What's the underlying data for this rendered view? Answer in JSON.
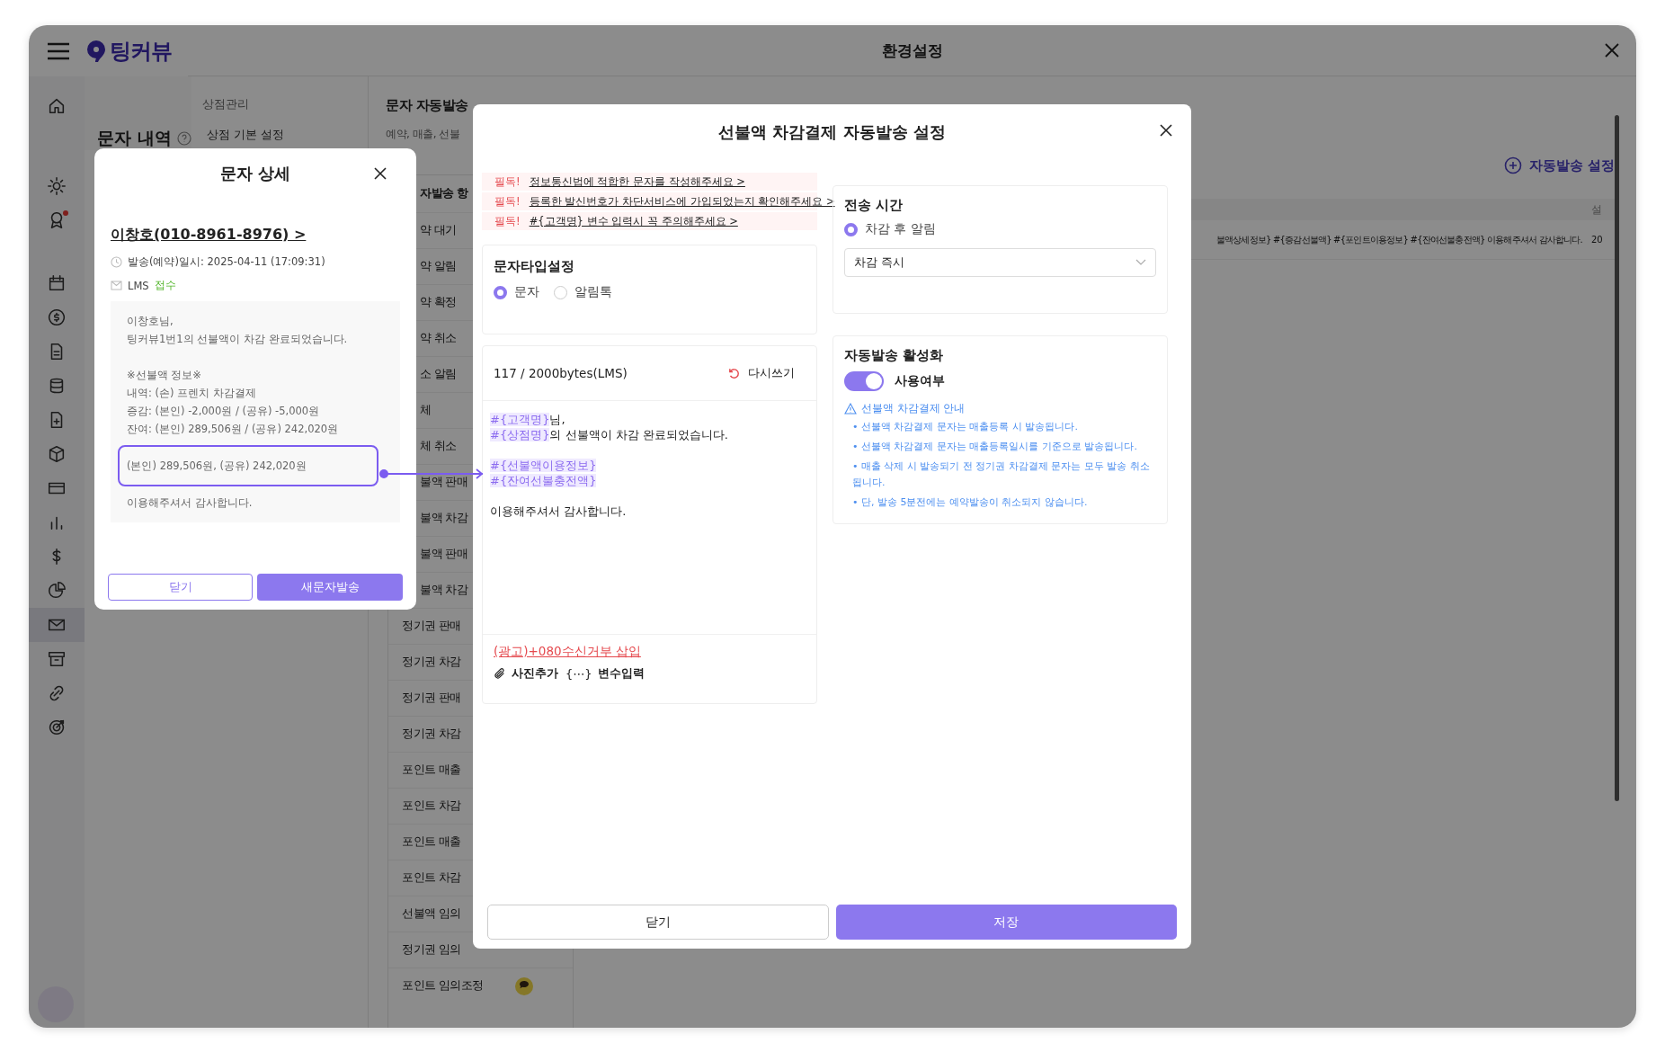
{
  "app": {
    "logo": "팅커뷰",
    "page_title": "문자 내역",
    "nav_groups": [
      [
        {
          "selected": false,
          "dot": false
        }
      ],
      [
        {
          "selected": false,
          "dot": false
        },
        {
          "selected": false,
          "dot": true
        }
      ],
      [
        {
          "selected": false,
          "dot": false
        },
        {
          "selected": false,
          "dot": false
        },
        {
          "selected": false,
          "dot": false
        },
        {
          "selected": false,
          "dot": false
        },
        {
          "selected": false,
          "dot": false
        },
        {
          "selected": false,
          "dot": false
        },
        {
          "selected": false,
          "dot": false
        },
        {
          "selected": false,
          "dot": false
        },
        {
          "selected": false,
          "dot": false
        },
        {
          "selected": false,
          "dot": false
        },
        {
          "selected": true,
          "dot": false
        },
        {
          "selected": false,
          "dot": false
        },
        {
          "selected": false,
          "dot": false
        },
        {
          "selected": false,
          "dot": false
        }
      ]
    ]
  },
  "settings_window": {
    "title": "환경설정",
    "nav": [
      {
        "kind": "group",
        "label": "상점관리"
      },
      {
        "kind": "item",
        "label": "상점 기본 설정"
      }
    ],
    "section_title": "문자 자동발송",
    "section_subtitle": "예약, 매출, 선불",
    "list_header": "자발송 항",
    "list_items_cut": [
      "약 대기",
      "약 알림",
      "약 확정",
      "약 취소",
      "소 알림",
      "체",
      "체 취소",
      "불액 판매",
      "불액 차감",
      "불액 판매",
      "불액 차감"
    ],
    "list_items": [
      {
        "label": "정기권 판매",
        "badge": false
      },
      {
        "label": "정기권 차감",
        "badge": false
      },
      {
        "label": "정기권 판매",
        "badge": false
      },
      {
        "label": "정기권 차감",
        "badge": false
      },
      {
        "label": "포인트 매출",
        "badge": false
      },
      {
        "label": "포인트 차감",
        "badge": false
      },
      {
        "label": "포인트 매출",
        "badge": false
      },
      {
        "label": "포인트 차감",
        "badge": false
      },
      {
        "label": "선불액 임의",
        "badge": false
      },
      {
        "label": "정기권 임의",
        "badge": false
      },
      {
        "label": "포인트 임의조정",
        "badge": true
      }
    ],
    "add_button": "자동발송 설정",
    "table": {
      "columns": [
        "설"
      ],
      "rows": [
        {
          "template": "불액상세정보} #{증감선불액} #{포인트이용정보} #{잔여선불충전액} 이용해주셔서 감사합니다.",
          "column_2": "20"
        }
      ]
    }
  },
  "message_dialog": {
    "title": "문자 상세",
    "recipient": "이창호(010-8961-8976) >",
    "sent_at": "발송(예약)일시: 2025-04-11 (17:09:31)",
    "type": "LMS",
    "status": "접수",
    "paragraphs": [
      [
        "이창호님,",
        "팅커뷰1번1의 선불액이 차감 완료되었습니다."
      ],
      [
        "※선불액 정보※",
        "내역: (손) 프렌치 차감결제",
        "증감: (본인) -2,000원 / (공유) -5,000원",
        "잔여: (본인) 289,506원 / (공유) 242,020원"
      ]
    ],
    "highlight": "(본인) 289,506원, (공유) 242,020원",
    "closing": "이용해주셔서 감사합니다.",
    "close_button": "닫기",
    "primary_button": "새문자발송"
  },
  "settings_dialog": {
    "title": "선불액 차감결제 자동발송 설정",
    "notices": [
      {
        "tag": "필독!",
        "text": "정보통신법에 적합한 문자를 작성해주세요 >"
      },
      {
        "tag": "필독!",
        "text": "등록한 발신번호가 차단서비스에 가입되었는지 확인해주세요 >"
      },
      {
        "tag": "필독!",
        "text": "#{고객명} 변수 입력시 꼭 주의해주세요 >"
      }
    ],
    "message_type": {
      "title": "문자타입설정",
      "options": [
        {
          "label": "문자",
          "selected": true
        },
        {
          "label": "알림톡",
          "selected": false
        }
      ]
    },
    "editor": {
      "byte_count": "117 / 2000bytes(LMS)",
      "reset": "다시쓰기",
      "paragraphs": [
        [
          [
            {
              "kind": "variable",
              "text": "#{고객명}"
            },
            {
              "kind": "plain",
              "text": "님,"
            }
          ],
          [
            {
              "kind": "variable",
              "text": "#{상점명}"
            },
            {
              "kind": "plain",
              "text": "의 선불액이 차감 완료되었습니다."
            }
          ]
        ],
        [
          [
            {
              "kind": "variable",
              "text": "#{선불액이용정보}"
            }
          ],
          [
            {
              "kind": "variable",
              "text": "#{잔여선불충전액}"
            }
          ]
        ],
        [
          [
            {
              "kind": "plain",
              "text": "이용해주셔서 감사합니다."
            }
          ]
        ]
      ],
      "ad_link": "(광고)+080수신거부 삽입",
      "add_photo": "사진추가",
      "variable_icon": "{⋯}",
      "variable_input": "변수입력"
    },
    "send_time": {
      "title": "전송 시간",
      "options": [
        {
          "label": "차감 후 알림",
          "selected": true
        }
      ],
      "select_value": "차감 즉시"
    },
    "activation": {
      "title": "자동발송 활성화",
      "toggle_label": "사용여부",
      "on": true,
      "notice_title": "선불액 차감결제 안내",
      "notice_items": [
        "• 선불액 차감결제 문자는 매출등록 시 발송됩니다.",
        "• 선불액 차감결제 문자는 매출등록일시를 기준으로 발송됩니다.",
        "• 매출 삭제 시 발송되기 전 정기권 차감결제 문자는 모두 발송 취소됩니다.",
        "• 단, 발송 5분전에는 예약발송이 취소되지 않습니다."
      ]
    },
    "close_button": "닫기",
    "save_button": "저장"
  }
}
